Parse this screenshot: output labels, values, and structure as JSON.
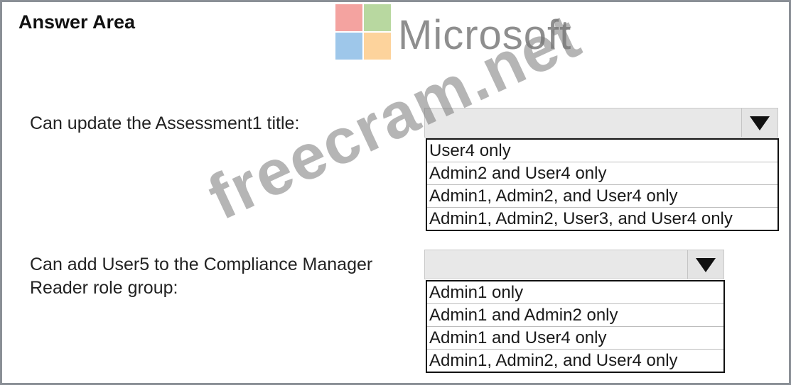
{
  "header": {
    "title": "Answer Area"
  },
  "logo": {
    "text": "Microsoft",
    "colors": [
      "#f4a3a0",
      "#b8d8a0",
      "#9ec7ea",
      "#fdd39c"
    ]
  },
  "questions": [
    {
      "label": "Can update the Assessment1 title:",
      "options": [
        "User4 only",
        "Admin2 and User4 only",
        "Admin1, Admin2, and User4 only",
        "Admin1, Admin2, User3, and User4 only"
      ]
    },
    {
      "label_line1": "Can add User5 to the Compliance Manager",
      "label_line2": "Reader role group:",
      "options": [
        "Admin1 only",
        "Admin1 and Admin2 only",
        "Admin1 and User4 only",
        "Admin1, Admin2, and User4 only"
      ]
    }
  ],
  "watermark": "freecram.net",
  "icons": {
    "dropdown_arrow": "triangle-down-icon"
  }
}
